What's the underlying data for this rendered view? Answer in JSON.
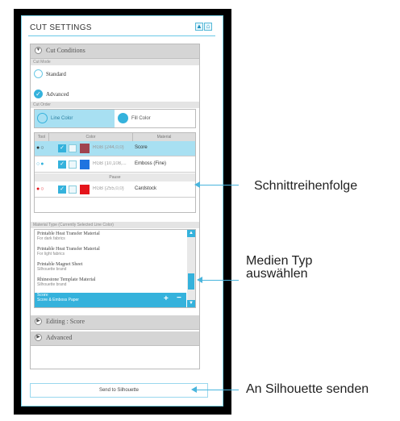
{
  "header": {
    "title": "CUT SETTINGS"
  },
  "sections": {
    "cut_conditions": "Cut Conditions",
    "editing": "Editing : Score",
    "advanced": "Advanced"
  },
  "cut_mode": {
    "label": "Cut Mode",
    "options": [
      "Standard",
      "Advanced"
    ],
    "selected": "Advanced"
  },
  "cut_order": {
    "label": "Cut Order",
    "tabs": [
      "Line Color",
      "Fill Color"
    ],
    "active_tab": "Line Color",
    "columns": [
      "Tool",
      "Color",
      "Material"
    ],
    "rows": [
      {
        "rgb": "RGB (244,0,0)",
        "material": "Score",
        "swatch": "#a0434f"
      },
      {
        "rgb": "RGB (10,108,...",
        "material": "Emboss (Fine)",
        "swatch": "#1f74e0"
      },
      {
        "rgb": "RGB (255,0,0)",
        "material": "Cardstock",
        "swatch": "#e4141b"
      }
    ],
    "pause_label": "Pause"
  },
  "material_type": {
    "label": "Material Type (Currently Selected Line Color)",
    "items": [
      {
        "name": "Printable Heat Transfer Material",
        "desc": "For dark fabrics"
      },
      {
        "name": "Printable Heat Transfer Material",
        "desc": "For light fabrics"
      },
      {
        "name": "Printable Magnet Sheet",
        "desc": "Silhouette brand"
      },
      {
        "name": "Rhinestone Template Material",
        "desc": "Silhouette brand"
      },
      {
        "name": "Score",
        "desc": "Score & Emboss Paper"
      }
    ],
    "selected": "Score"
  },
  "send_button": "Send to Silhouette",
  "annotations": {
    "cut_order": "Schnittreihenfolge",
    "media_type_1": "Medien Typ",
    "media_type_2": "auswählen",
    "send": "An Silhouette senden"
  },
  "colors": {
    "accent": "#35b2dc",
    "selected_row": "#a8e0f2"
  }
}
